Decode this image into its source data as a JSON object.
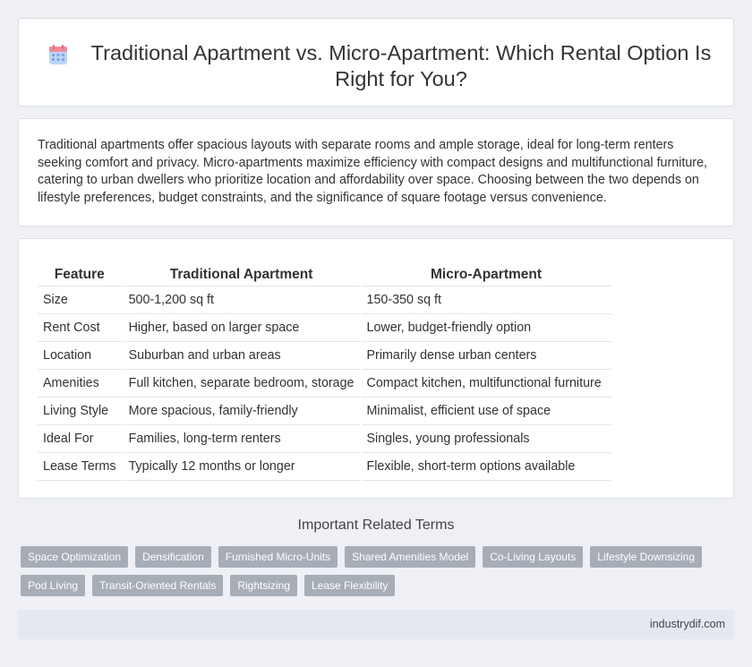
{
  "title": "Traditional Apartment vs. Micro-Apartment: Which Rental Option Is Right for You?",
  "title_icon": "calendar-icon",
  "intro": "Traditional apartments offer spacious layouts with separate rooms and ample storage, ideal for long-term renters seeking comfort and privacy. Micro-apartments maximize efficiency with compact designs and multifunctional furniture, catering to urban dwellers who prioritize location and affordability over space. Choosing between the two depends on lifestyle preferences, budget constraints, and the significance of square footage versus convenience.",
  "table": {
    "headers": [
      "Feature",
      "Traditional Apartment",
      "Micro-Apartment"
    ],
    "rows": [
      [
        "Size",
        "500-1,200 sq ft",
        "150-350 sq ft"
      ],
      [
        "Rent Cost",
        "Higher, based on larger space",
        "Lower, budget-friendly option"
      ],
      [
        "Location",
        "Suburban and urban areas",
        "Primarily dense urban centers"
      ],
      [
        "Amenities",
        "Full kitchen, separate bedroom, storage",
        "Compact kitchen, multifunctional furniture"
      ],
      [
        "Living Style",
        "More spacious, family-friendly",
        "Minimalist, efficient use of space"
      ],
      [
        "Ideal For",
        "Families, long-term renters",
        "Singles, young professionals"
      ],
      [
        "Lease Terms",
        "Typically 12 months or longer",
        "Flexible, short-term options available"
      ]
    ]
  },
  "related": {
    "title": "Important Related Terms",
    "tags": [
      "Space Optimization",
      "Densification",
      "Furnished Micro-Units",
      "Shared Amenities Model",
      "Co-Living Layouts",
      "Lifestyle Downsizing",
      "Pod Living",
      "Transit-Oriented Rentals",
      "Rightsizing",
      "Lease Flexibility"
    ]
  },
  "footer": "industrydif.com",
  "colors": {
    "background": "#eef0f5",
    "tag": "#a7adb6",
    "footer": "#e4e8f1",
    "icon_top": "#f08a9a",
    "icon_body": "#8fb8f0"
  }
}
